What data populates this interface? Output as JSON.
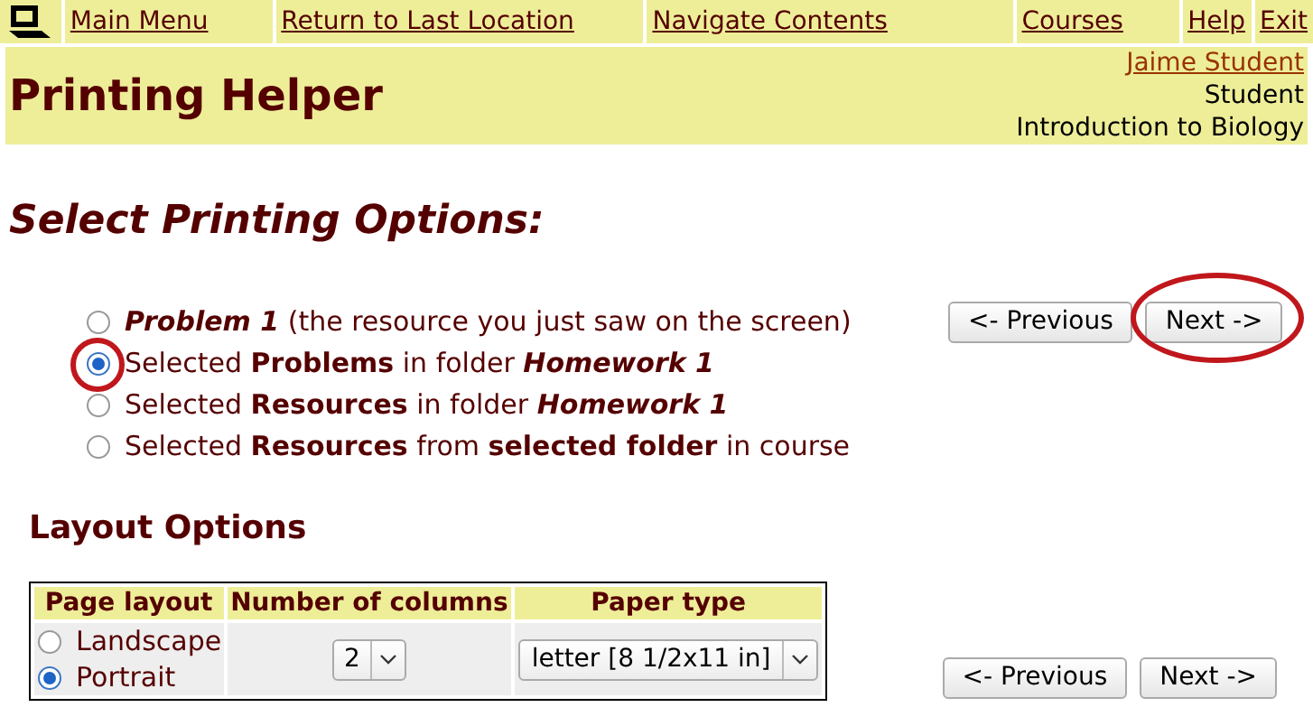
{
  "menu": [
    {
      "label": "Main Menu"
    },
    {
      "label": "Return to Last Location"
    },
    {
      "label": "Navigate Contents"
    },
    {
      "label": "Courses"
    },
    {
      "label": "Help"
    },
    {
      "label": "Exit"
    }
  ],
  "header": {
    "title": "Printing Helper",
    "user": "Jaime Student",
    "role": "Student",
    "course": "Introduction to Biology"
  },
  "heading": "Select Printing Options:",
  "options": [
    {
      "label": "*Problem 1* (the resource you just saw on the screen)",
      "selected": false,
      "circled": false
    },
    {
      "label": "Selected **Problems** in folder *Homework 1*",
      "selected": true,
      "circled": true
    },
    {
      "label": "Selected **Resources** in folder *Homework 1*",
      "selected": false,
      "circled": false
    },
    {
      "label": "Selected **Resources** from **selected folder** in course",
      "selected": false,
      "circled": false
    }
  ],
  "nav_top": {
    "previous": "<- Previous",
    "next": "Next ->",
    "next_circled": true
  },
  "layout_heading": "Layout Options",
  "layout_table": {
    "columns": [
      "Page layout",
      "Number of columns",
      "Paper type"
    ],
    "orientations": [
      {
        "label": "Landscape",
        "selected": false
      },
      {
        "label": "Portrait",
        "selected": true
      }
    ],
    "columns_value": "2",
    "paper_value": "letter [8 1/2x11 in]"
  },
  "nav_bottom": {
    "previous": "<- Previous",
    "next": "Next ->"
  }
}
